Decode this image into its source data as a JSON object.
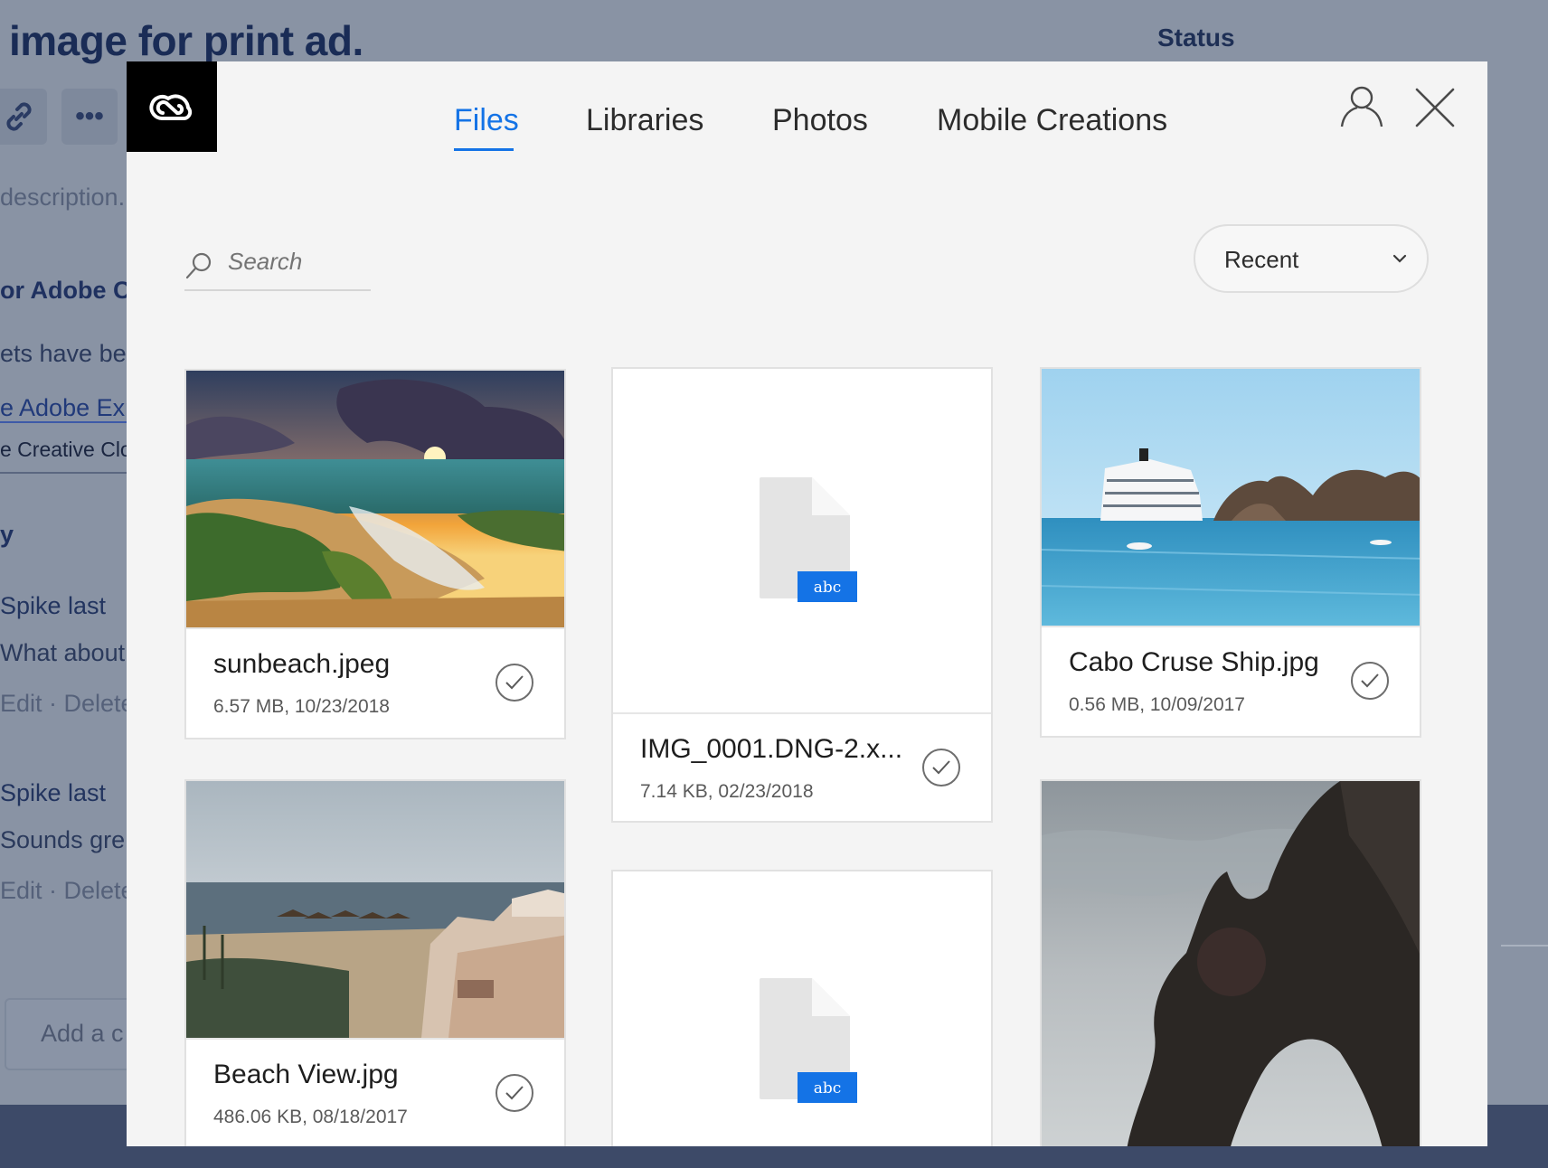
{
  "background": {
    "title": "image for print ad.",
    "status_label": "Status",
    "link_btn_icon": "link-icon",
    "more_btn_label": "•••",
    "lines": [
      "description.",
      "or Adobe C",
      "ets have be",
      "e Adobe Exp",
      "e Creative Clo",
      "y",
      "Spike  last",
      "What about",
      "Edit · Delete",
      "Spike  last",
      "Sounds gre",
      "Edit · Delete"
    ],
    "comment_placeholder": "Add a c"
  },
  "modal": {
    "logo_icon": "creative-cloud-logo-icon",
    "tabs": [
      {
        "label": "Files",
        "active": true
      },
      {
        "label": "Libraries",
        "active": false
      },
      {
        "label": "Photos",
        "active": false
      },
      {
        "label": "Mobile Creations",
        "active": false
      }
    ],
    "user_icon": "user-icon",
    "close_icon": "close-icon",
    "search": {
      "placeholder": "Search"
    },
    "sort": {
      "selected": "Recent"
    },
    "accent_color": "#1473e6",
    "files": [
      {
        "name": "sunbeach.jpeg",
        "info": "6.57 MB, 10/23/2018",
        "thumb": "sunset-beach-photo"
      },
      {
        "name": "IMG_0001.DNG-2.x...",
        "info": "7.14 KB, 02/23/2018",
        "thumb": "generic-file-icon",
        "file_badge": "abc"
      },
      {
        "name": "Cabo Cruse Ship.jpg",
        "info": "0.56 MB, 10/09/2017",
        "thumb": "cruise-ship-photo"
      },
      {
        "name": "Beach View.jpg",
        "info": "486.06 KB, 08/18/2017",
        "thumb": "beach-resort-photo"
      },
      {
        "name": "",
        "info": "",
        "thumb": "generic-file-icon",
        "file_badge": "abc"
      },
      {
        "name": "",
        "info": "",
        "thumb": "rock-arch-photo"
      }
    ]
  }
}
